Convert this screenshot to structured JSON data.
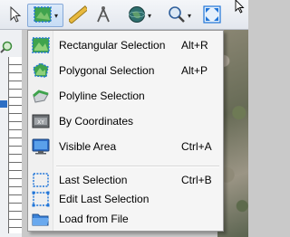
{
  "toolbar": {
    "tools": [
      {
        "name": "select-arrow",
        "icon": "cursor-arrow-icon"
      },
      {
        "name": "area-selection",
        "icon": "selection-area-icon",
        "pressed": true,
        "dropdown": true
      },
      {
        "name": "ruler",
        "icon": "ruler-icon"
      },
      {
        "name": "compass",
        "icon": "compass-icon"
      },
      {
        "name": "globe",
        "icon": "globe-icon",
        "dropdown": true
      },
      {
        "name": "zoom",
        "icon": "magnifier-icon",
        "dropdown": true
      },
      {
        "name": "full-extent",
        "icon": "full-extent-icon"
      }
    ]
  },
  "menu": {
    "items": [
      {
        "label": "Rectangular Selection",
        "shortcut": "Alt+R",
        "icon": "rectangular-selection-icon"
      },
      {
        "label": "Polygonal Selection",
        "shortcut": "Alt+P",
        "icon": "polygonal-selection-icon"
      },
      {
        "label": "Polyline Selection",
        "shortcut": "",
        "icon": "polyline-selection-icon"
      },
      {
        "label": "By Coordinates",
        "shortcut": "",
        "icon": "coordinates-icon"
      },
      {
        "label": "Visible Area",
        "shortcut": "Ctrl+A",
        "icon": "monitor-icon"
      }
    ],
    "items2": [
      {
        "label": "Last Selection",
        "shortcut": "Ctrl+B",
        "icon": "last-selection-icon"
      },
      {
        "label": "Edit Last Selection",
        "shortcut": "",
        "icon": "edit-selection-icon"
      },
      {
        "label": "Load from File",
        "shortcut": "",
        "icon": "folder-icon"
      }
    ]
  },
  "colors": {
    "accent": "#1e74d8",
    "menu_background": "#f5f5f5",
    "toolbar_pressed": "#c6dcf5"
  }
}
